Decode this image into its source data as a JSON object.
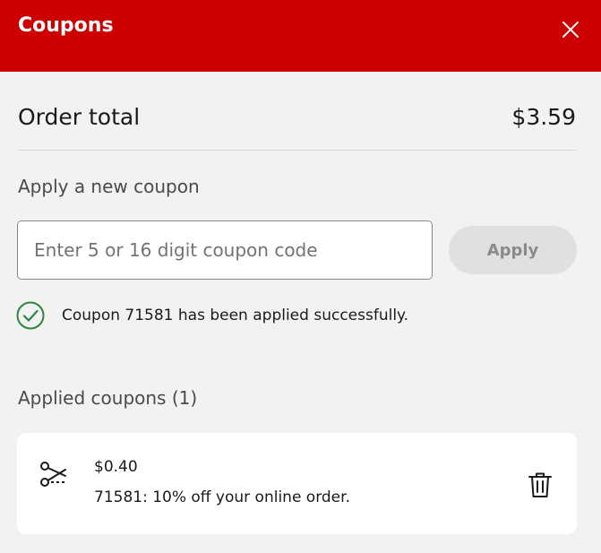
{
  "header": {
    "title": "Coupons",
    "close_icon": "close-icon"
  },
  "order": {
    "label": "Order total",
    "value": "$3.59"
  },
  "apply_section": {
    "heading": "Apply a new coupon",
    "input_placeholder": "Enter 5 or 16 digit coupon code",
    "input_value": "",
    "apply_label": "Apply"
  },
  "success": {
    "icon": "check-circle-icon",
    "message": "Coupon 71581 has been applied successfully.",
    "color": "#2e8540"
  },
  "applied": {
    "heading": "Applied coupons (1)",
    "coupons": [
      {
        "icon": "scissors-icon",
        "amount": "$0.40",
        "description": "71581: 10% off your online order.",
        "remove_icon": "trash-icon"
      }
    ]
  },
  "colors": {
    "brand": "#cc0000",
    "background": "#f2f2f2",
    "card": "#ffffff",
    "button_disabled": "#e0e0e0"
  }
}
